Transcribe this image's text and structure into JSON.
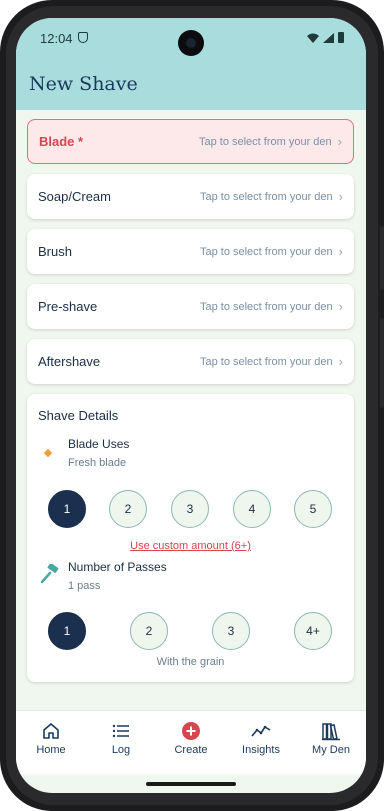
{
  "status_bar": {
    "time": "12:04"
  },
  "header": {
    "title": "New Shave"
  },
  "selectors": [
    {
      "label": "Blade *",
      "hint": "Tap to select from your den",
      "required": true
    },
    {
      "label": "Soap/Cream",
      "hint": "Tap to select from your den"
    },
    {
      "label": "Brush",
      "hint": "Tap to select from your den"
    },
    {
      "label": "Pre-shave",
      "hint": "Tap to select from your den"
    },
    {
      "label": "Aftershave",
      "hint": "Tap to select from your den"
    }
  ],
  "shave_details": {
    "title": "Shave Details",
    "blade_uses": {
      "title": "Blade Uses",
      "subtitle": "Fresh blade",
      "options": [
        "1",
        "2",
        "3",
        "4",
        "5"
      ],
      "selected": "1",
      "custom_link": "Use custom amount (6+)"
    },
    "passes": {
      "title": "Number of Passes",
      "subtitle": "1 pass",
      "options": [
        "1",
        "2",
        "3",
        "4+"
      ],
      "selected": "1",
      "caption": "With the grain"
    }
  },
  "bottom_nav": [
    {
      "label": "Home",
      "icon": "home-icon"
    },
    {
      "label": "Log",
      "icon": "list-icon"
    },
    {
      "label": "Create",
      "icon": "plus-circle-icon"
    },
    {
      "label": "Insights",
      "icon": "trend-icon"
    },
    {
      "label": "My Den",
      "icon": "library-icon"
    }
  ],
  "colors": {
    "header_bg": "#a9dcdc",
    "primary_navy": "#1b2f4e",
    "accent_red": "#d64550",
    "screen_bg": "#f0f7ef"
  }
}
